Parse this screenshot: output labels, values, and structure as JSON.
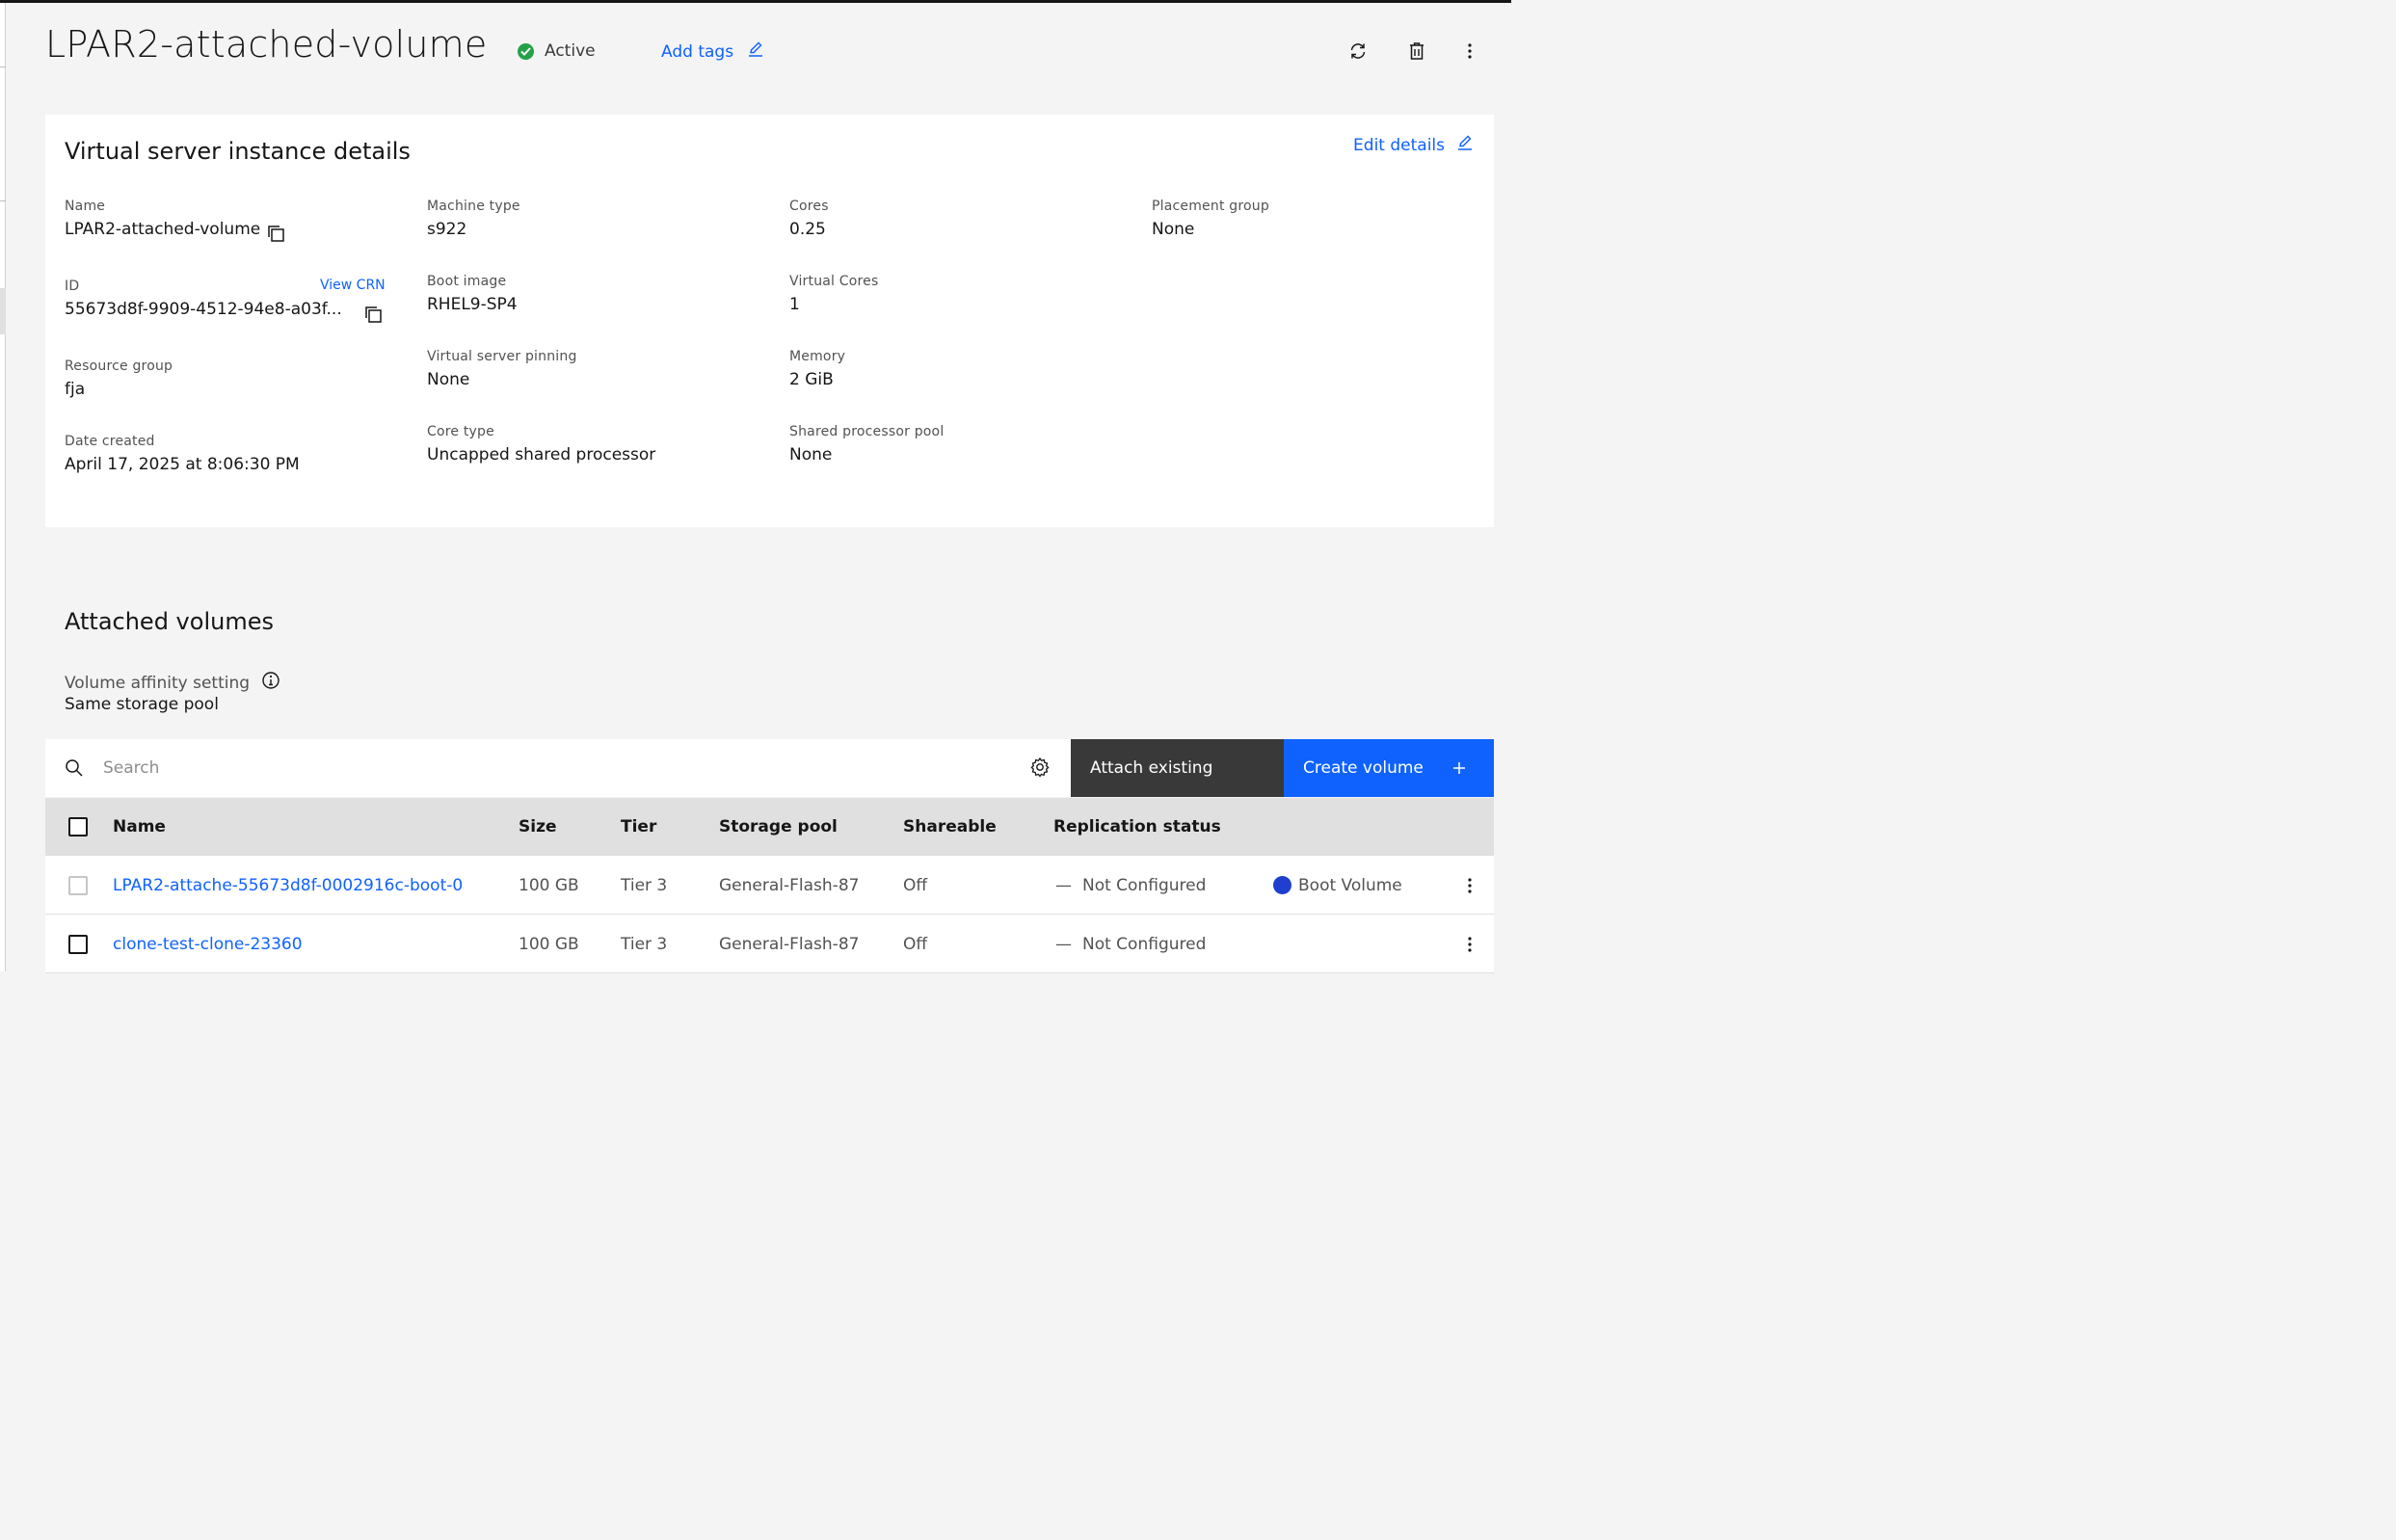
{
  "header": {
    "title": "LPAR2-attached-volume",
    "status": "Active",
    "add_tags": "Add tags"
  },
  "details": {
    "title": "Virtual server instance details",
    "edit_label": "Edit details",
    "view_crn": "View CRN",
    "fields": {
      "name": {
        "label": "Name",
        "value": "LPAR2-attached-volume"
      },
      "id": {
        "label": "ID",
        "value": "55673d8f-9909-4512-94e8-a03f..."
      },
      "resource_group": {
        "label": "Resource group",
        "value": "fja"
      },
      "date_created": {
        "label": "Date created",
        "value": "April 17, 2025 at 8:06:30 PM"
      },
      "machine_type": {
        "label": "Machine type",
        "value": "s922"
      },
      "boot_image": {
        "label": "Boot image",
        "value": "RHEL9-SP4"
      },
      "pinning": {
        "label": "Virtual server pinning",
        "value": "None"
      },
      "core_type": {
        "label": "Core type",
        "value": "Uncapped shared processor"
      },
      "cores": {
        "label": "Cores",
        "value": "0.25"
      },
      "virtual_cores": {
        "label": "Virtual Cores",
        "value": "1"
      },
      "memory": {
        "label": "Memory",
        "value": "2 GiB"
      },
      "shared_pool": {
        "label": "Shared processor pool",
        "value": "None"
      },
      "placement_group": {
        "label": "Placement group",
        "value": "None"
      }
    }
  },
  "volumes": {
    "title": "Attached volumes",
    "affinity_label": "Volume affinity setting",
    "affinity_value": "Same storage pool",
    "search_placeholder": "Search",
    "attach_label": "Attach existing",
    "create_label": "Create volume",
    "columns": [
      "Name",
      "Size",
      "Tier",
      "Storage pool",
      "Shareable",
      "Replication status"
    ],
    "rows": [
      {
        "name": "LPAR2-attache-55673d8f-0002916c-boot-0",
        "size": "100 GB",
        "tier": "Tier 3",
        "pool": "General-Flash-87",
        "shareable": "Off",
        "dash": "—",
        "replication": "Not Configured",
        "tag": "Boot Volume"
      },
      {
        "name": "clone-test-clone-23360",
        "size": "100 GB",
        "tier": "Tier 3",
        "pool": "General-Flash-87",
        "shareable": "Off",
        "dash": "—",
        "replication": "Not Configured",
        "tag": ""
      }
    ]
  },
  "colors": {
    "accent": "#0f62fe",
    "success": "#24a148",
    "boot_tag": "#1f3fcf",
    "secondary_button": "#393939"
  },
  "icons": [
    "checkmark-filled-icon",
    "edit-icon",
    "renew-icon",
    "trash-can-icon",
    "overflow-menu-icon",
    "copy-icon",
    "information-icon",
    "search-icon",
    "settings-icon",
    "add-icon"
  ]
}
